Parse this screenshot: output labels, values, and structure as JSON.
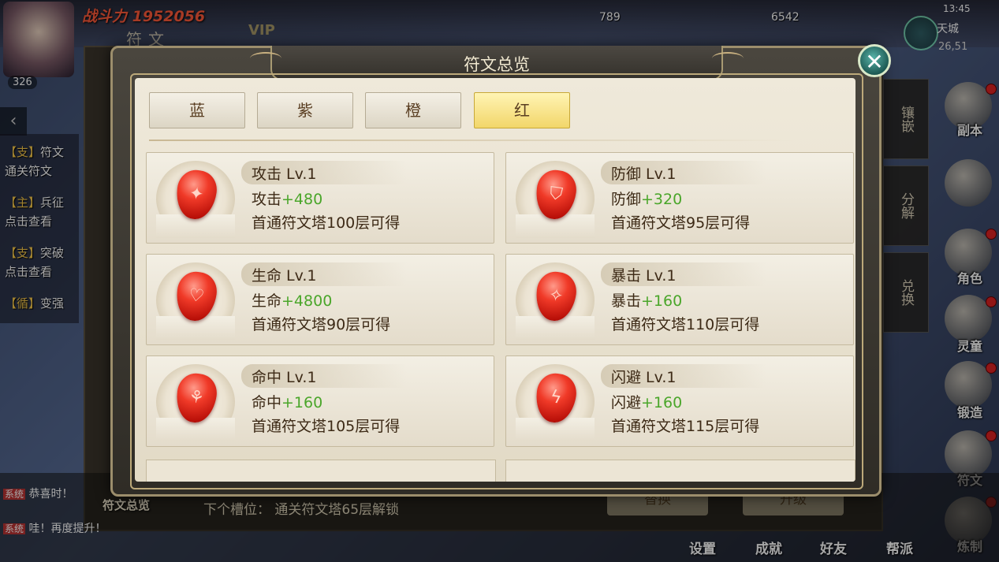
{
  "background": {
    "power_label": "战斗力 1952056",
    "panel_title": "符文",
    "vip": "VIP",
    "level": "326",
    "resource_1": "789",
    "resource_2": "6542",
    "clock": "13:45",
    "location": "天城",
    "coords": "26,51",
    "chat": [
      {
        "tag": "【支】",
        "text": "符文",
        "sub": "通关符文"
      },
      {
        "tag": "【主】",
        "text": "兵征",
        "sub": "点击查看"
      },
      {
        "tag": "【支】",
        "text": "突破",
        "sub": "点击查看"
      },
      {
        "tag": "【循】",
        "text": "变强",
        "sub": ""
      }
    ],
    "system_messages": [
      {
        "tag": "系统",
        "text": "恭喜时！"
      },
      {
        "tag": "系统",
        "text": "哇！再度提升！"
      }
    ],
    "side_tabs": [
      "镶嵌",
      "分解",
      "兑换"
    ],
    "right_menu": [
      "副本",
      "角色",
      "灵童",
      "锻造",
      "符文",
      "炼制"
    ],
    "bottom_menu": [
      "设置",
      "成就",
      "好友",
      "帮派"
    ],
    "summary_button": "符文总览",
    "next_slot": "下个槽位：  通关符文塔65层解锁",
    "under_buttons": [
      "替换",
      "升级"
    ]
  },
  "modal": {
    "title": "符文总览",
    "close_icon": "close-x-icon",
    "tabs": [
      {
        "label": "蓝",
        "active": false
      },
      {
        "label": "紫",
        "active": false
      },
      {
        "label": "橙",
        "active": false
      },
      {
        "label": "红",
        "active": true
      }
    ],
    "runes": [
      {
        "name": "攻击  Lv.1",
        "stat": "攻击",
        "bonus": "+480",
        "source": "首通符文塔100层可得",
        "icon": "sword-rune-icon"
      },
      {
        "name": "防御  Lv.1",
        "stat": "防御",
        "bonus": "+320",
        "source": "首通符文塔95层可得",
        "icon": "shield-rune-icon"
      },
      {
        "name": "生命  Lv.1",
        "stat": "生命",
        "bonus": "+4800",
        "source": "首通符文塔90层可得",
        "icon": "heart-rune-icon"
      },
      {
        "name": "暴击  Lv.1",
        "stat": "暴击",
        "bonus": "+160",
        "source": "首通符文塔110层可得",
        "icon": "crit-rune-icon"
      },
      {
        "name": "命中  Lv.1",
        "stat": "命中",
        "bonus": "+160",
        "source": "首通符文塔105层可得",
        "icon": "target-rune-icon"
      },
      {
        "name": "闪避  Lv.1",
        "stat": "闪避",
        "bonus": "+160",
        "source": "首通符文塔115层可得",
        "icon": "dodge-rune-icon"
      }
    ]
  },
  "colors": {
    "bonus_green": "#4aa62a",
    "active_tab": "#f2d66a",
    "gem_red": "#f03a28"
  }
}
